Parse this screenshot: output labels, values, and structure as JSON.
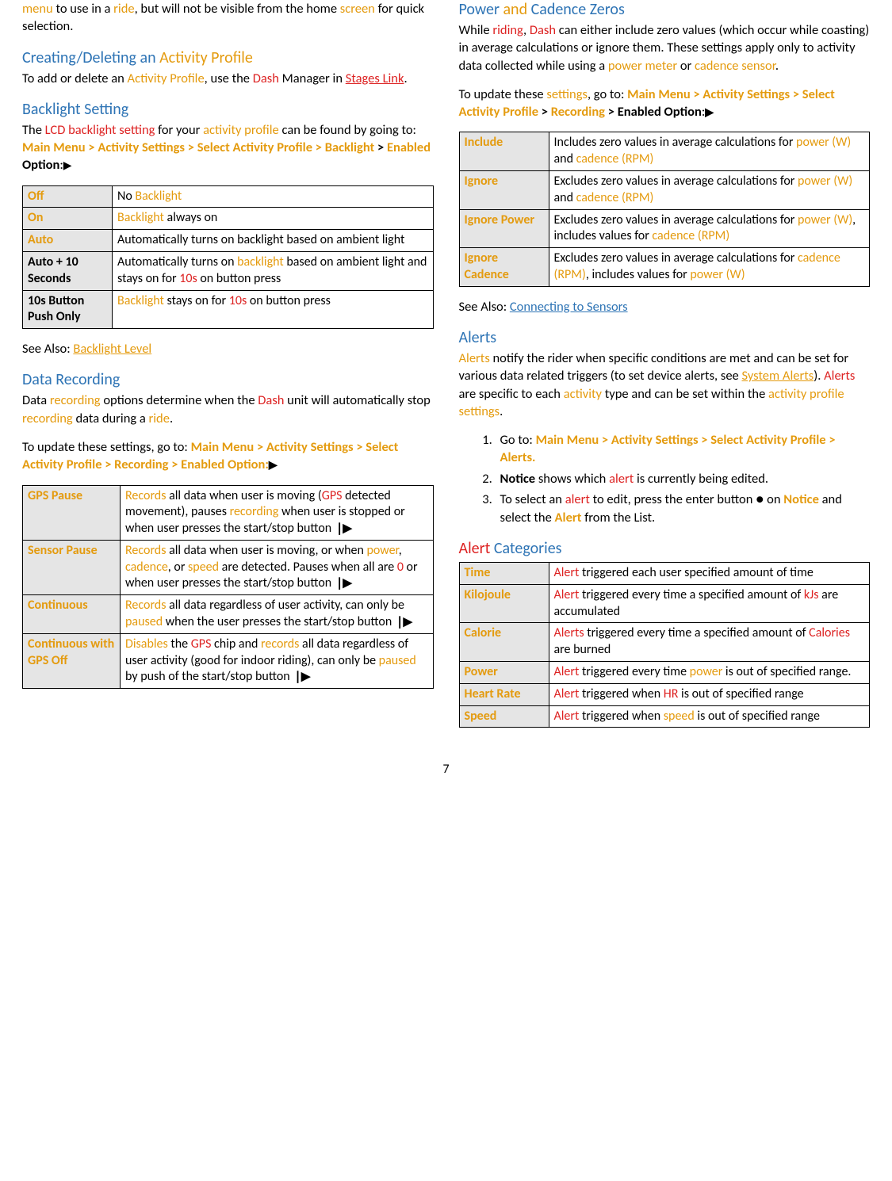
{
  "page_number": "7",
  "col_left": {
    "intro_fragment": {
      "pre1": "menu",
      "pre2": " to use in a ",
      "ride": "ride",
      "mid": ", but will not be visible from the home ",
      "screen": "screen",
      "tail": " for quick selection."
    },
    "create_delete": {
      "heading_pre": "Creating/Deleting an ",
      "heading_orange": "Activity Profile",
      "body_pre": "To add or delete an ",
      "ap": "Activity Profile",
      "mid": ", use the ",
      "dash": "Dash",
      "mid2": " Manager in ",
      "link": "Stages Link",
      "tail": "."
    },
    "backlight": {
      "heading": "Backlight Setting",
      "p1_a": "The ",
      "p1_b": "LCD",
      "p1_c": " ",
      "p1_d": "backlight setting",
      "p1_e": " for your ",
      "p1_f": "activity profile",
      "p1_g": " can be found by going to: ",
      "nav1": "Main Menu > Activity Settings > Select Activity Profile > ",
      "nav1_b": "Backlight",
      "nav1_c": " > ",
      "nav1_enabled": "Enabled",
      "nav1_opt": " Option",
      "rows": [
        {
          "k": "Off",
          "v_pre": "No ",
          "v_hl": "Backlight",
          "v_tail": ""
        },
        {
          "k": "On",
          "v_pre": "",
          "v_hl": "Backlight",
          "v_tail": " always on"
        },
        {
          "k": "Auto",
          "v_plain": "Automatically turns on backlight based on ambient light"
        },
        {
          "k": "Auto + 10 Seconds",
          "parts": [
            "Automatically turns on ",
            "backlight",
            " based on ambient light and stays on for ",
            "10s",
            " on button press"
          ]
        },
        {
          "k": "10s Button Push Only",
          "parts": [
            "",
            "Backlight",
            " stays on for ",
            "10s",
            " on button press"
          ]
        }
      ],
      "see_also_label": "See Also: ",
      "see_also_link": "Backlight Level"
    },
    "data_rec": {
      "heading": "Data Recording",
      "p1_a": "Data ",
      "p1_b": "recording",
      "p1_c": " options determine when the ",
      "p1_d": "Dash",
      "p1_e": " unit will automatically stop ",
      "p1_f": "recording",
      "p1_g": " data during a ",
      "p1_h": "ride",
      "p1_i": ".",
      "p2_a": "To update these settings, go to: ",
      "nav": "Main Menu > Activity Settings > Select Activity Profile > Recording > Enabled Option:",
      "rows": {
        "r1_k": "GPS Pause",
        "r1_p": [
          "Records",
          " all data when user is moving (",
          "GPS",
          " detected movement), pauses ",
          "recording",
          " when user is stopped or when user presses the start/stop button "
        ],
        "r2_k": "Sensor Pause",
        "r2_p": [
          "Records",
          " all data when user is moving, or when ",
          "power",
          ", ",
          "cadence",
          ", or ",
          "speed",
          " are detected. Pauses when all are ",
          "0",
          " or when user presses the start/stop button "
        ],
        "r3_k": "Continuous",
        "r3_p": [
          "Records",
          " all data regardless of user activity, can only be ",
          "paused",
          " when the user presses the start/stop button "
        ],
        "r4_k": "Continuous with GPS Off",
        "r4_p": [
          "Disables",
          " the ",
          "GPS",
          " chip and ",
          "records",
          " all data regardless of user activity (good for indoor riding), can only be ",
          "paused",
          " by push of the start/stop button "
        ]
      }
    }
  },
  "col_right": {
    "power_zeros": {
      "heading_a": "Power",
      "heading_b": " and ",
      "heading_c": "Cadence ",
      "heading_d": "Zeros",
      "p1": [
        "While ",
        "riding",
        ", ",
        "Dash",
        " can either include zero values (which occur while coasting) in average calculations or ignore them. These settings apply only to activity data collected while using a ",
        "power meter",
        " or ",
        "cadence sensor",
        "."
      ],
      "p2_a": "To update these ",
      "p2_b": "settings",
      "p2_c": ", go to: ",
      "nav_a": "Main Menu > Activity Settings > Select Activity Profile",
      "nav_b": " > ",
      "nav_c": "Recording",
      "nav_d": " > ",
      "nav_e": "Enabled Option",
      "rows": [
        {
          "k": "Include",
          "p": [
            "Includes zero values in average calculations for ",
            "power (W)",
            " and ",
            "cadence (RPM)"
          ]
        },
        {
          "k": "Ignore",
          "p": [
            "Excludes zero values in average calculations for ",
            "power (W)",
            " and ",
            "cadence (RPM)"
          ]
        },
        {
          "k": "Ignore Power",
          "p": [
            "Excludes zero values in average calculations for ",
            "power (W)",
            ", includes values for ",
            "cadence (RPM)"
          ]
        },
        {
          "k": "Ignore Cadence",
          "p": [
            "Excludes zero values in average calculations for ",
            "cadence (RPM)",
            ", includes values for ",
            "power (W)"
          ]
        }
      ],
      "see_also_label": "See Also: ",
      "see_also_link": "Connecting to Sensors"
    },
    "alerts": {
      "heading": "Alerts",
      "p1": [
        "Alerts",
        " notify the rider when specific conditions are met and can be set for various data related triggers (to set device alerts, see ",
        "System Alerts",
        "). ",
        "Alerts",
        " are specific to each ",
        "activity",
        " type and can be set within the ",
        "activity profile settings",
        "."
      ],
      "steps": {
        "s1_a": "Go to: ",
        "s1_b": "Main Menu > Activity Settings > Select Activity Profile > Alerts.",
        "s2_a": "Notice",
        "s2_b": " shows which ",
        "s2_c": "alert",
        "s2_d": " is currently being edited.",
        "s3_a": "To select an ",
        "s3_b": "alert",
        "s3_c": " to edit, press the enter button ",
        "s3_d": " on ",
        "s3_e": "Notice",
        "s3_f": " and select the ",
        "s3_g": "Alert",
        "s3_h": " from the List."
      }
    },
    "alert_cat": {
      "heading_a": "Alert",
      "heading_b": " Categories",
      "rows": [
        {
          "k": "Time",
          "p": [
            "Alert",
            " triggered each user specified amount of time"
          ]
        },
        {
          "k": "Kilojoule",
          "p": [
            "Alert",
            " triggered every time a specified amount of ",
            "kJs",
            " are accumulated"
          ]
        },
        {
          "k": "Calorie",
          "p": [
            "Alerts",
            " triggered every time a specified amount of ",
            "Calories",
            " are burned"
          ]
        },
        {
          "k": "Power",
          "p": [
            "Alert",
            " triggered every time ",
            "power",
            " is out of specified range."
          ]
        },
        {
          "k": "Heart Rate",
          "p": [
            "Alert",
            " triggered when ",
            "HR",
            " is out of specified range"
          ]
        },
        {
          "k": "Speed",
          "p": [
            "Alert",
            " triggered when ",
            "speed",
            " is out of specified range"
          ]
        }
      ]
    }
  }
}
